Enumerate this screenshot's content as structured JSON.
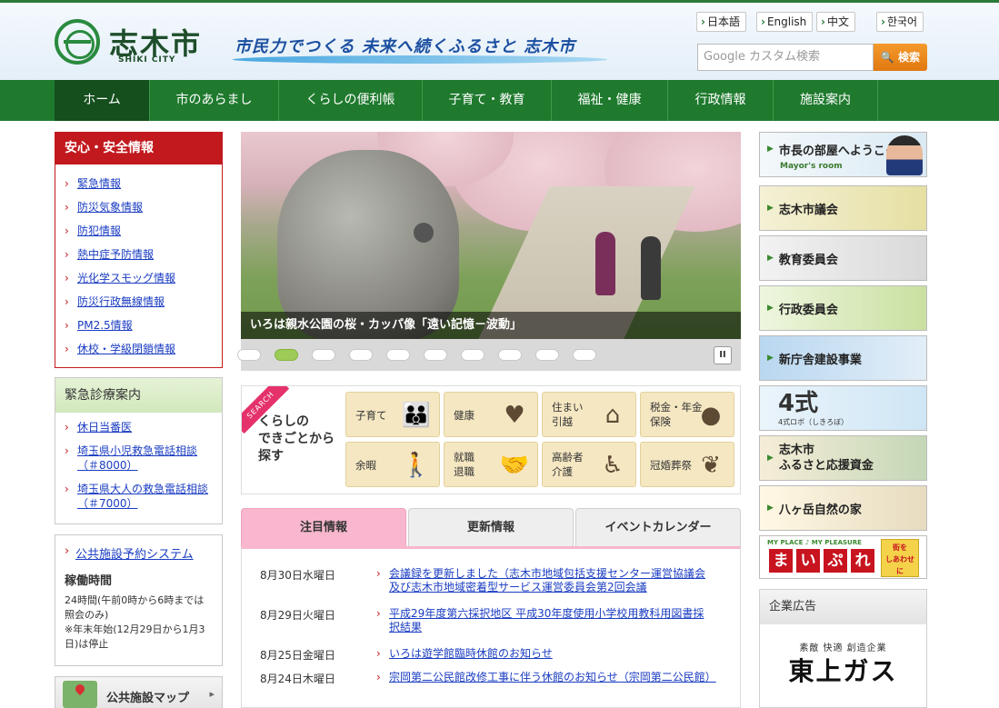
{
  "header": {
    "logo_name": "志木市",
    "logo_sub": "SHIKI CITY",
    "slogan": "市民力でつくる 未来へ続くふるさと 志木市",
    "languages": [
      "日本語",
      "English",
      "中文",
      "한국어"
    ],
    "search_placeholder": "Google カスタム検索",
    "search_button": "検索"
  },
  "nav": [
    "ホーム",
    "市のあらまし",
    "くらしの便利帳",
    "子育て・教育",
    "福祉・健康",
    "行政情報",
    "施設案内"
  ],
  "safety": {
    "title": "安心・安全情報",
    "links": [
      "緊急情報",
      "防災気象情報",
      "防犯情報",
      "熱中症予防情報",
      "光化学スモッグ情報",
      "防災行政無線情報",
      "PM2.5情報",
      "休校・学級閉鎖情報"
    ]
  },
  "clinic": {
    "title": "緊急診療案内",
    "links": [
      "休日当番医",
      "埼玉県小児救急電話相談（＃8000）",
      "埼玉県大人の救急電話相談（＃7000）"
    ]
  },
  "reserve": {
    "link": "公共施設予約システム",
    "heading": "稼働時間",
    "text": "24時間(午前0時から6時までは照会のみ)\n※年末年始(12月29日から1月3日)は停止"
  },
  "map": {
    "label": "公共施設マップ"
  },
  "slideshow": {
    "caption": "いろは親水公園の桜・カッパ像「遠い記憶－波動」",
    "dot_count": 10,
    "active_dot": 2,
    "pause_label": "II"
  },
  "life": {
    "ribbon": "SEARCH",
    "title": "くらしの\nできごとから\n探す",
    "items": [
      {
        "label": "子育て",
        "icon": "family-icon",
        "glyph": "👪"
      },
      {
        "label": "健康",
        "icon": "hearts-icon",
        "glyph": "♥"
      },
      {
        "label": "住まい\n引越",
        "icon": "house-icon",
        "glyph": "⌂"
      },
      {
        "label": "税金・年金\n保険",
        "icon": "purse-icon",
        "glyph": "●"
      },
      {
        "label": "余暇",
        "icon": "walker-icon",
        "glyph": "🚶"
      },
      {
        "label": "就職\n退職",
        "icon": "handshake-icon",
        "glyph": "🤝"
      },
      {
        "label": "高齢者\n介護",
        "icon": "elderly-icon",
        "glyph": "♿"
      },
      {
        "label": "冠婚葬祭",
        "icon": "plant-icon",
        "glyph": "❦"
      }
    ]
  },
  "tabs": [
    "注目情報",
    "更新情報",
    "イベントカレンダー"
  ],
  "news": [
    {
      "date": "8月30日水曜日",
      "text": "会議録を更新しました（志木市地域包括支援センター運営協議会及び志木市地域密着型サービス運営委員会第2回会議"
    },
    {
      "date": "8月29日火曜日",
      "text": "平成29年度第六採択地区 平成30年度使用小学校用教科用図書採択結果"
    },
    {
      "date": "8月25日金曜日",
      "text": "いろは遊学館臨時休館のお知らせ"
    },
    {
      "date": "8月24日木曜日",
      "text": "宗岡第二公民館改修工事に伴う休館のお知らせ（宗岡第二公民館）"
    }
  ],
  "banners": {
    "mayor": "市長の部屋へようこそ",
    "mayor_sub": "Mayor's room",
    "council": "志木市議会",
    "education": "教育委員会",
    "admin": "行政委員会",
    "newhall": "新庁舎建設事業",
    "four": "4式",
    "four_sub": "4式ロボ（しきろぼ）",
    "furusato": "志木市\nふるさと応援資金",
    "yatsugatake": "八ヶ岳自然の家",
    "myplace_top": "MY PLACE ♪ MY PLEASURE",
    "myplace_chars": [
      "ま",
      "い",
      "ぷ",
      "れ"
    ],
    "myplace_side": "街を\nしあわせ\nに"
  },
  "ads": {
    "title": "企業広告",
    "sub": "素敵 快適 創造企業",
    "name": "東上ガス"
  }
}
